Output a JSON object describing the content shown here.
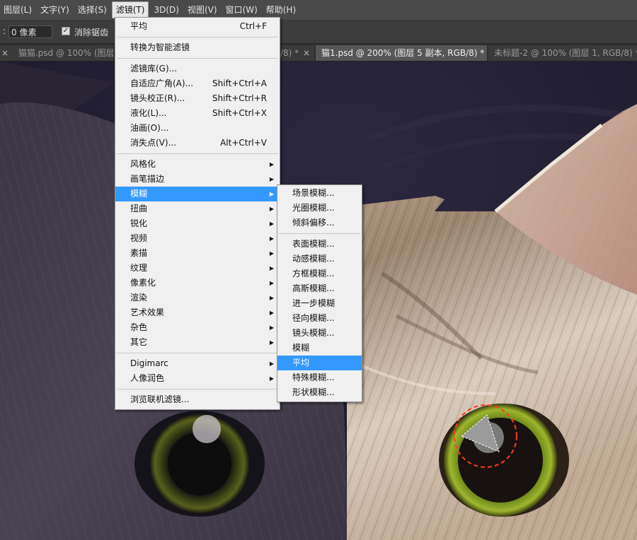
{
  "menubar": {
    "items": [
      "图层(L)",
      "文字(Y)",
      "选择(S)",
      "滤镜(T)",
      "3D(D)",
      "视图(V)",
      "窗口(W)",
      "帮助(H)"
    ]
  },
  "options": {
    "colon": ":",
    "feather_value": "0 像素",
    "antialias_checked": true,
    "antialias_label": "消除锯齿"
  },
  "tabs": [
    {
      "label": "猫猫.psd @ 100% (图层",
      "close": "×"
    },
    {
      "label": "/8) *",
      "close": "×"
    },
    {
      "label": "猫1.psd @ 200% (图层 5 副本, RGB/8) *",
      "close": "×"
    },
    {
      "label": "未标题-2 @ 100% (图层 1, RGB/8) *",
      "close": "×"
    }
  ],
  "filter_menu": {
    "last_filter": {
      "label": "平均",
      "shortcut": "Ctrl+F"
    },
    "convert_smart": "转换为智能滤镜",
    "group1": [
      {
        "label": "滤镜库(G)...",
        "shortcut": ""
      },
      {
        "label": "自适应广角(A)...",
        "shortcut": "Shift+Ctrl+A"
      },
      {
        "label": "镜头校正(R)...",
        "shortcut": "Shift+Ctrl+R"
      },
      {
        "label": "液化(L)...",
        "shortcut": "Shift+Ctrl+X"
      },
      {
        "label": "油画(O)...",
        "shortcut": ""
      },
      {
        "label": "消失点(V)...",
        "shortcut": "Alt+Ctrl+V"
      }
    ],
    "group2": [
      "风格化",
      "画笔描边",
      "模糊",
      "扭曲",
      "锐化",
      "视频",
      "素描",
      "纹理",
      "像素化",
      "渲染",
      "艺术效果",
      "杂色",
      "其它"
    ],
    "group3": [
      "Digimarc",
      "人像润色"
    ],
    "browse": "浏览联机滤镜..."
  },
  "blur_submenu": {
    "group1": [
      "场景模糊...",
      "光圈模糊...",
      "倾斜偏移..."
    ],
    "group2": [
      "表面模糊...",
      "动感模糊...",
      "方框模糊...",
      "高斯模糊...",
      "进一步模糊",
      "径向模糊...",
      "镜头模糊...",
      "模糊",
      "平均",
      "特殊模糊...",
      "形状模糊..."
    ]
  },
  "colors": {
    "highlight": "#3399ff",
    "selection_marker": "#ff3b1f"
  }
}
